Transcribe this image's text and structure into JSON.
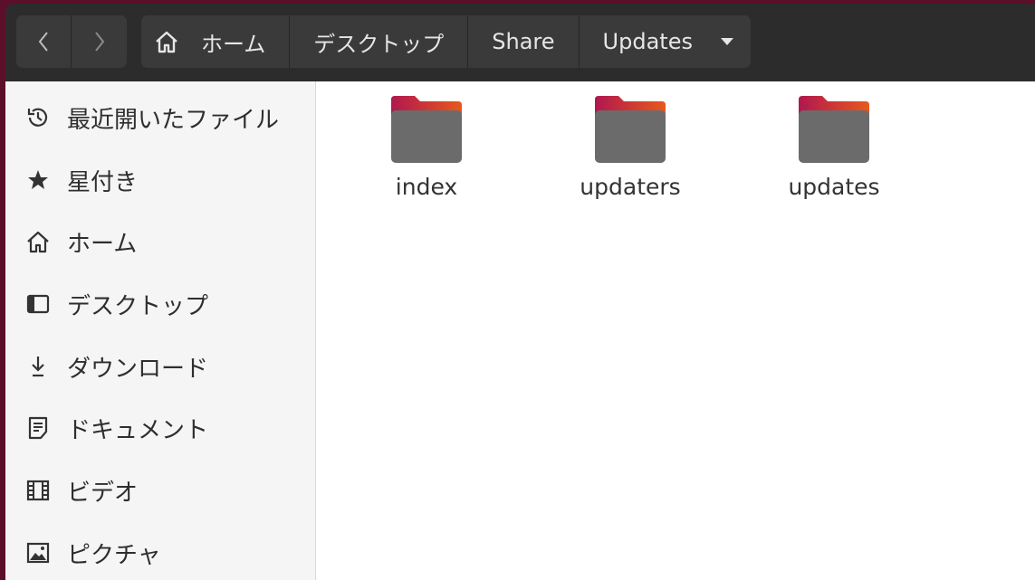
{
  "header": {
    "back_icon": "chevron-left-icon",
    "forward_icon": "chevron-right-icon",
    "breadcrumbs": [
      {
        "label": "ホーム",
        "icon": "home-icon"
      },
      {
        "label": "デスクトップ"
      },
      {
        "label": "Share"
      },
      {
        "label": "Updates",
        "icon": "dropdown-caret-icon"
      }
    ]
  },
  "sidebar": {
    "items": [
      {
        "label": "最近開いたファイル",
        "icon": "recent-icon"
      },
      {
        "label": "星付き",
        "icon": "star-icon"
      },
      {
        "label": "ホーム",
        "icon": "home-icon"
      },
      {
        "label": "デスクトップ",
        "icon": "desktop-icon"
      },
      {
        "label": "ダウンロード",
        "icon": "download-icon"
      },
      {
        "label": "ドキュメント",
        "icon": "document-icon"
      },
      {
        "label": "ビデオ",
        "icon": "video-icon"
      },
      {
        "label": "ピクチャ",
        "icon": "picture-icon"
      }
    ]
  },
  "files": [
    {
      "name": "index",
      "icon": "folder-icon"
    },
    {
      "name": "updaters",
      "icon": "folder-icon"
    },
    {
      "name": "updates",
      "icon": "folder-icon"
    }
  ],
  "colors": {
    "folder_tab": "#c2185b",
    "folder_tab_accent": "#e65100",
    "folder_body": "#6b6b6b",
    "header_bg": "#2c2c2c",
    "sidebar_bg": "#f5f5f5"
  }
}
